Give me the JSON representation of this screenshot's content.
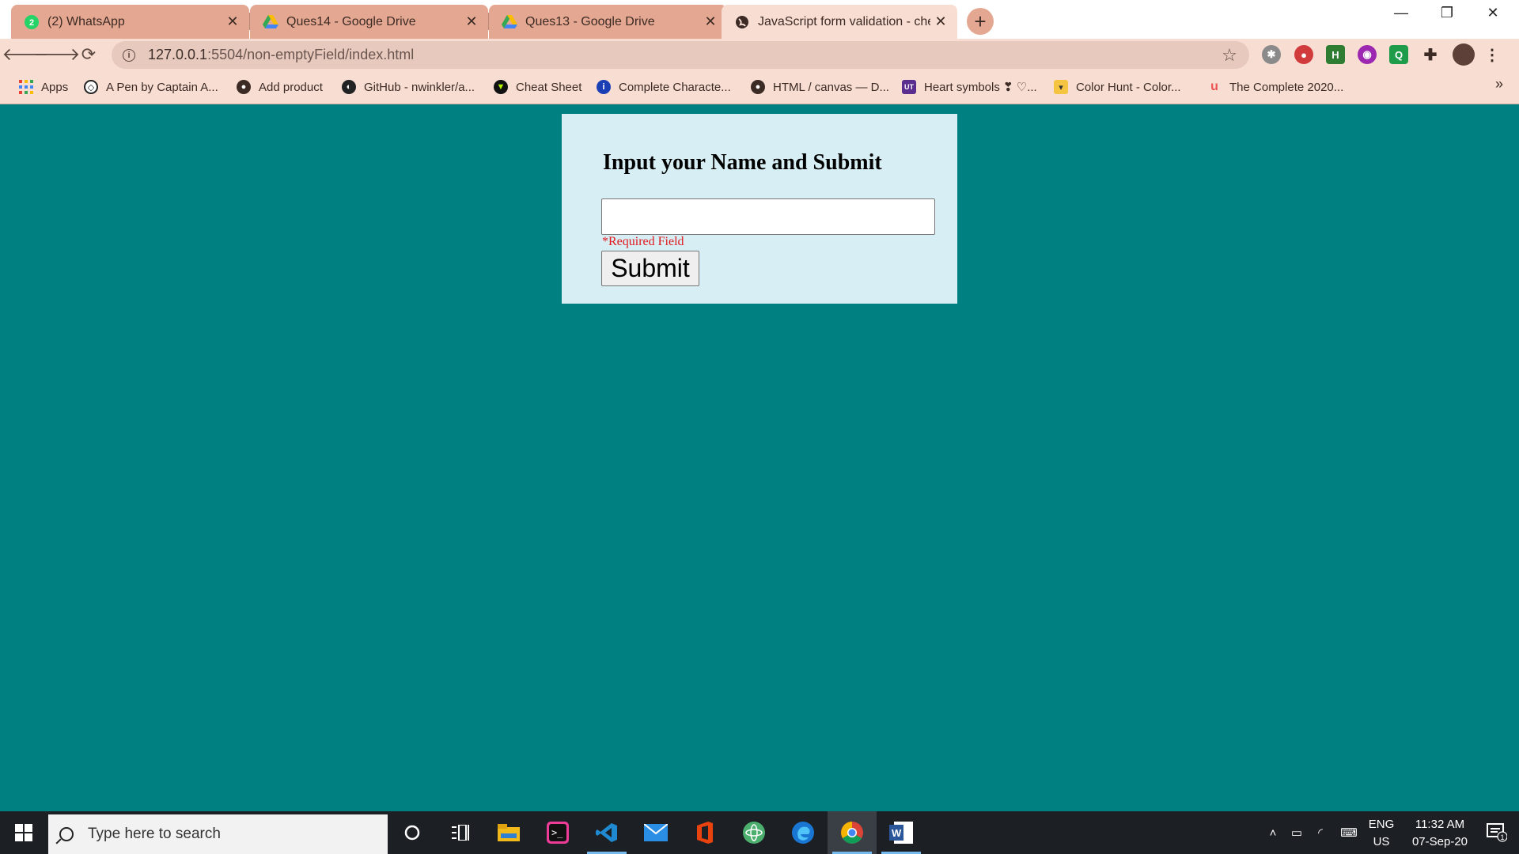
{
  "browser": {
    "tabs": [
      {
        "title": "(2) WhatsApp",
        "icon": "whatsapp-icon",
        "badge": "2",
        "active": false
      },
      {
        "title": "Ques14 - Google Drive",
        "icon": "google-drive-icon",
        "active": false
      },
      {
        "title": "Ques13 - Google Drive",
        "icon": "google-drive-icon",
        "active": false
      },
      {
        "title": "JavaScript form validation - check",
        "icon": "globe-icon",
        "active": true
      }
    ],
    "url_host": "127.0.0.1",
    "url_path": ":5504/non-emptyField/index.html",
    "bookmarks": [
      {
        "label": "Apps",
        "icon": "apps-grid-icon"
      },
      {
        "label": "A Pen by Captain A...",
        "icon": "codepen-icon"
      },
      {
        "label": "Add product",
        "icon": "globe-icon"
      },
      {
        "label": "GitHub - nwinkler/a...",
        "icon": "github-icon"
      },
      {
        "label": "Cheat Sheet",
        "icon": "cheat-sheet-icon"
      },
      {
        "label": "Complete Characte...",
        "icon": "info-icon"
      },
      {
        "label": "HTML / canvas — D...",
        "icon": "globe-icon"
      },
      {
        "label": "Heart symbols ❣ ♡...",
        "icon": "ut-icon"
      },
      {
        "label": "Color Hunt - Color...",
        "icon": "color-hunt-icon"
      },
      {
        "label": "The Complete 2020...",
        "icon": "udemy-icon"
      }
    ],
    "more_bookmarks": "»"
  },
  "form": {
    "heading": "Input your Name and Submit",
    "input_value": "",
    "required_text": "*Required Field",
    "submit_label": "Submit"
  },
  "taskbar": {
    "search_placeholder": "Type here to search",
    "lang_top": "ENG",
    "lang_bottom": "US",
    "time": "11:32 AM",
    "date": "07-Sep-20",
    "notification_count": "1"
  },
  "colors": {
    "page_background": "#008080",
    "card_background": "#d8eef5",
    "required_text": "#e0181c",
    "tab_inactive": "#e4a791",
    "tab_active": "#f7ddd2"
  }
}
